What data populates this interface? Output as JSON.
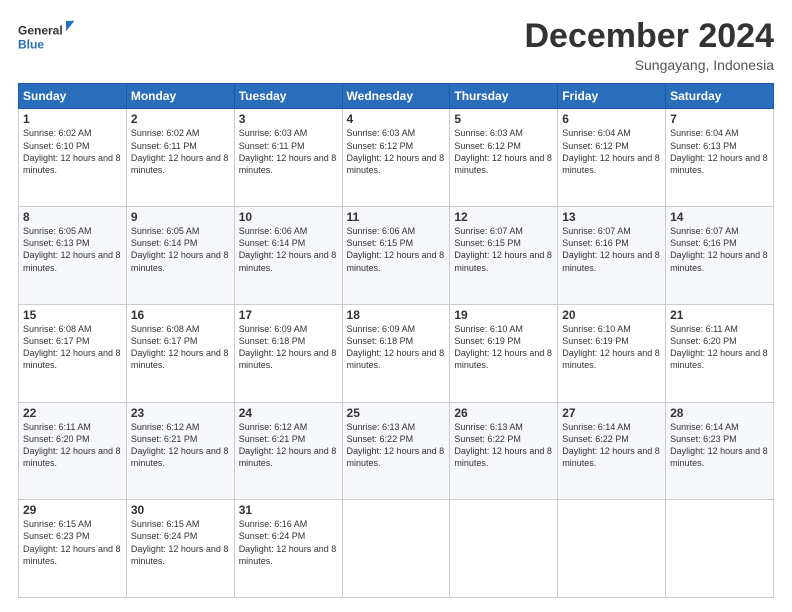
{
  "logo": {
    "line1": "General",
    "line2": "Blue"
  },
  "title": "December 2024",
  "subtitle": "Sungayang, Indonesia",
  "weekdays": [
    "Sunday",
    "Monday",
    "Tuesday",
    "Wednesday",
    "Thursday",
    "Friday",
    "Saturday"
  ],
  "weeks": [
    [
      {
        "day": "1",
        "sunrise": "6:02 AM",
        "sunset": "6:10 PM",
        "daylight": "12 hours and 8 minutes."
      },
      {
        "day": "2",
        "sunrise": "6:02 AM",
        "sunset": "6:11 PM",
        "daylight": "12 hours and 8 minutes."
      },
      {
        "day": "3",
        "sunrise": "6:03 AM",
        "sunset": "6:11 PM",
        "daylight": "12 hours and 8 minutes."
      },
      {
        "day": "4",
        "sunrise": "6:03 AM",
        "sunset": "6:12 PM",
        "daylight": "12 hours and 8 minutes."
      },
      {
        "day": "5",
        "sunrise": "6:03 AM",
        "sunset": "6:12 PM",
        "daylight": "12 hours and 8 minutes."
      },
      {
        "day": "6",
        "sunrise": "6:04 AM",
        "sunset": "6:12 PM",
        "daylight": "12 hours and 8 minutes."
      },
      {
        "day": "7",
        "sunrise": "6:04 AM",
        "sunset": "6:13 PM",
        "daylight": "12 hours and 8 minutes."
      }
    ],
    [
      {
        "day": "8",
        "sunrise": "6:05 AM",
        "sunset": "6:13 PM",
        "daylight": "12 hours and 8 minutes."
      },
      {
        "day": "9",
        "sunrise": "6:05 AM",
        "sunset": "6:14 PM",
        "daylight": "12 hours and 8 minutes."
      },
      {
        "day": "10",
        "sunrise": "6:06 AM",
        "sunset": "6:14 PM",
        "daylight": "12 hours and 8 minutes."
      },
      {
        "day": "11",
        "sunrise": "6:06 AM",
        "sunset": "6:15 PM",
        "daylight": "12 hours and 8 minutes."
      },
      {
        "day": "12",
        "sunrise": "6:07 AM",
        "sunset": "6:15 PM",
        "daylight": "12 hours and 8 minutes."
      },
      {
        "day": "13",
        "sunrise": "6:07 AM",
        "sunset": "6:16 PM",
        "daylight": "12 hours and 8 minutes."
      },
      {
        "day": "14",
        "sunrise": "6:07 AM",
        "sunset": "6:16 PM",
        "daylight": "12 hours and 8 minutes."
      }
    ],
    [
      {
        "day": "15",
        "sunrise": "6:08 AM",
        "sunset": "6:17 PM",
        "daylight": "12 hours and 8 minutes."
      },
      {
        "day": "16",
        "sunrise": "6:08 AM",
        "sunset": "6:17 PM",
        "daylight": "12 hours and 8 minutes."
      },
      {
        "day": "17",
        "sunrise": "6:09 AM",
        "sunset": "6:18 PM",
        "daylight": "12 hours and 8 minutes."
      },
      {
        "day": "18",
        "sunrise": "6:09 AM",
        "sunset": "6:18 PM",
        "daylight": "12 hours and 8 minutes."
      },
      {
        "day": "19",
        "sunrise": "6:10 AM",
        "sunset": "6:19 PM",
        "daylight": "12 hours and 8 minutes."
      },
      {
        "day": "20",
        "sunrise": "6:10 AM",
        "sunset": "6:19 PM",
        "daylight": "12 hours and 8 minutes."
      },
      {
        "day": "21",
        "sunrise": "6:11 AM",
        "sunset": "6:20 PM",
        "daylight": "12 hours and 8 minutes."
      }
    ],
    [
      {
        "day": "22",
        "sunrise": "6:11 AM",
        "sunset": "6:20 PM",
        "daylight": "12 hours and 8 minutes."
      },
      {
        "day": "23",
        "sunrise": "6:12 AM",
        "sunset": "6:21 PM",
        "daylight": "12 hours and 8 minutes."
      },
      {
        "day": "24",
        "sunrise": "6:12 AM",
        "sunset": "6:21 PM",
        "daylight": "12 hours and 8 minutes."
      },
      {
        "day": "25",
        "sunrise": "6:13 AM",
        "sunset": "6:22 PM",
        "daylight": "12 hours and 8 minutes."
      },
      {
        "day": "26",
        "sunrise": "6:13 AM",
        "sunset": "6:22 PM",
        "daylight": "12 hours and 8 minutes."
      },
      {
        "day": "27",
        "sunrise": "6:14 AM",
        "sunset": "6:22 PM",
        "daylight": "12 hours and 8 minutes."
      },
      {
        "day": "28",
        "sunrise": "6:14 AM",
        "sunset": "6:23 PM",
        "daylight": "12 hours and 8 minutes."
      }
    ],
    [
      {
        "day": "29",
        "sunrise": "6:15 AM",
        "sunset": "6:23 PM",
        "daylight": "12 hours and 8 minutes."
      },
      {
        "day": "30",
        "sunrise": "6:15 AM",
        "sunset": "6:24 PM",
        "daylight": "12 hours and 8 minutes."
      },
      {
        "day": "31",
        "sunrise": "6:16 AM",
        "sunset": "6:24 PM",
        "daylight": "12 hours and 8 minutes."
      },
      null,
      null,
      null,
      null
    ]
  ],
  "labels": {
    "sunrise": "Sunrise:",
    "sunset": "Sunset:",
    "daylight": "Daylight:"
  }
}
